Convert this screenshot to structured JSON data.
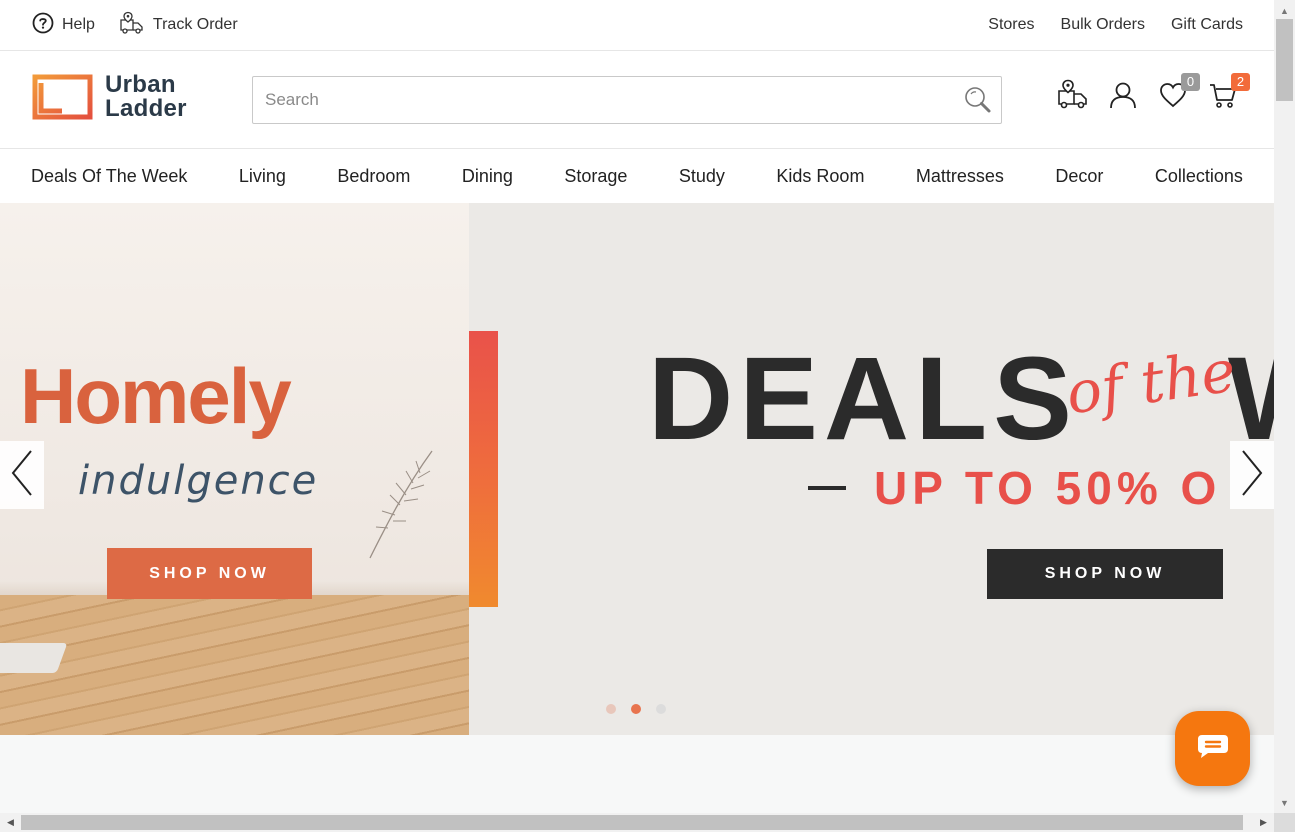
{
  "topbar": {
    "help_label": "Help",
    "track_order_label": "Track Order",
    "links": [
      "Stores",
      "Bulk Orders",
      "Gift Cards"
    ]
  },
  "header": {
    "logo_line1": "Urban",
    "logo_line2": "Ladder",
    "search_placeholder": "Search",
    "wishlist_count": "0",
    "cart_count": "2",
    "brand_color": "#f26b3a"
  },
  "nav": {
    "items": [
      "Deals Of The Week",
      "Living",
      "Bedroom",
      "Dining",
      "Storage",
      "Study",
      "Kids Room",
      "Mattresses",
      "Decor",
      "Collections"
    ]
  },
  "hero": {
    "left": {
      "title": "Homely",
      "subtitle": "indulgence",
      "cta": "SHOP NOW"
    },
    "right": {
      "title": "DEALS",
      "script": "of the",
      "title_tail": "W",
      "offer": "UP TO 50% O",
      "cta": "SHOP NOW"
    },
    "slides_total": 3,
    "active_slide_index": 1
  },
  "icons": {
    "help": "help-circle-icon",
    "track": "delivery-truck-icon",
    "search": "search-icon",
    "store_locator": "truck-location-icon",
    "account": "user-icon",
    "wishlist": "heart-icon",
    "cart": "cart-icon",
    "prev": "chevron-left-icon",
    "next": "chevron-right-icon",
    "chat": "chat-bubble-icon"
  }
}
